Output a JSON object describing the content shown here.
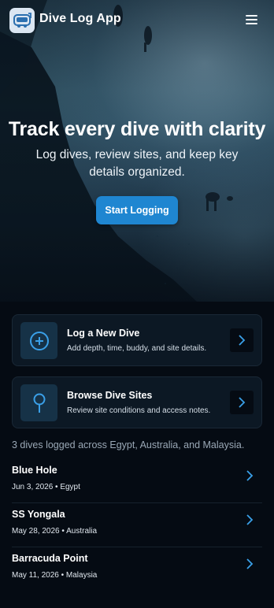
{
  "header": {
    "app_title": "Dive Log App",
    "logo_icon": "dive-logo-icon",
    "menu_icon": "hamburger-menu-icon"
  },
  "hero": {
    "title": "Track every dive with clarity",
    "subtitle": "Log dives, review sites, and keep key details organized.",
    "cta_label": "Start Logging"
  },
  "actions": [
    {
      "title": "Log a New Dive",
      "description": "Add depth, time, buddy, and site details.",
      "icon": "plus-circle-icon"
    },
    {
      "title": "Browse Dive Sites",
      "description": "Review site conditions and access notes.",
      "icon": "map-pin-icon"
    }
  ],
  "summary": "3 dives logged across Egypt, Australia, and Malaysia.",
  "dives": [
    {
      "name": "Blue Hole",
      "meta": "Jun 3, 2026 • Egypt"
    },
    {
      "name": "SS Yongala",
      "meta": "May 28, 2026 • Australia"
    },
    {
      "name": "Barracuda Point",
      "meta": "May 11, 2026 • Malaysia"
    }
  ],
  "colors": {
    "background": "#050b13",
    "card": "#0c1824",
    "accent": "#1f86d1",
    "icon_accent": "#3aa0e8"
  }
}
